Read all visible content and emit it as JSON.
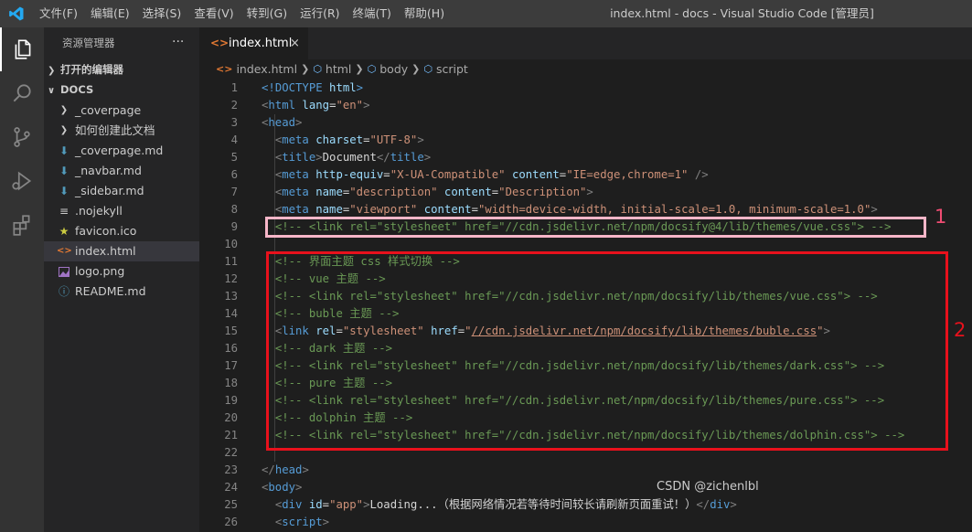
{
  "window": {
    "title": "index.html - docs - Visual Studio Code [管理员]"
  },
  "menu": [
    "文件(F)",
    "编辑(E)",
    "选择(S)",
    "查看(V)",
    "转到(G)",
    "运行(R)",
    "终端(T)",
    "帮助(H)"
  ],
  "sidebar": {
    "title": "资源管理器",
    "more": "···",
    "open_editors": "打开的编辑器",
    "folder": "DOCS",
    "items": [
      {
        "label": "_coverpage",
        "icon": "chevron-right-icon"
      },
      {
        "label": "如何创建此文档",
        "icon": "chevron-right-icon"
      },
      {
        "label": "_coverpage.md",
        "icon": "markdown-icon"
      },
      {
        "label": "_navbar.md",
        "icon": "markdown-icon"
      },
      {
        "label": "_sidebar.md",
        "icon": "markdown-icon"
      },
      {
        "label": ".nojekyll",
        "icon": "lines-icon"
      },
      {
        "label": "favicon.ico",
        "icon": "star-icon"
      },
      {
        "label": "index.html",
        "icon": "html-icon"
      },
      {
        "label": "logo.png",
        "icon": "image-icon"
      },
      {
        "label": "README.md",
        "icon": "info-icon"
      }
    ]
  },
  "editor": {
    "tab_label": "index.html",
    "tab_close": "×",
    "breadcrumb": [
      "index.html",
      "html",
      "body",
      "script"
    ],
    "line_numbers": [
      "1",
      "2",
      "3",
      "4",
      "5",
      "6",
      "7",
      "8",
      "9",
      "10",
      "11",
      "12",
      "13",
      "14",
      "15",
      "16",
      "17",
      "18",
      "19",
      "20",
      "21",
      "22",
      "23",
      "24",
      "25",
      "26"
    ],
    "lines": [
      [
        [
          "<!",
          "tg"
        ],
        [
          "DOCTYPE",
          "tg"
        ],
        [
          " html",
          "at"
        ],
        [
          ">",
          "tg"
        ]
      ],
      [
        [
          "<",
          "gr"
        ],
        [
          "html",
          "tg"
        ],
        [
          " lang",
          "at"
        ],
        [
          "=",
          "tx"
        ],
        [
          "\"en\"",
          "st"
        ],
        [
          ">",
          "gr"
        ]
      ],
      [
        [
          "<",
          "gr"
        ],
        [
          "head",
          "tg"
        ],
        [
          ">",
          "gr"
        ]
      ],
      [
        [
          "  ",
          "tx"
        ],
        [
          "<",
          "gr"
        ],
        [
          "meta",
          "tg"
        ],
        [
          " charset",
          "at"
        ],
        [
          "=",
          "tx"
        ],
        [
          "\"UTF-8\"",
          "st"
        ],
        [
          ">",
          "gr"
        ]
      ],
      [
        [
          "  ",
          "tx"
        ],
        [
          "<",
          "gr"
        ],
        [
          "title",
          "tg"
        ],
        [
          ">",
          "gr"
        ],
        [
          "Document",
          "tx"
        ],
        [
          "</",
          "gr"
        ],
        [
          "title",
          "tg"
        ],
        [
          ">",
          "gr"
        ]
      ],
      [
        [
          "  ",
          "tx"
        ],
        [
          "<",
          "gr"
        ],
        [
          "meta",
          "tg"
        ],
        [
          " http-equiv",
          "at"
        ],
        [
          "=",
          "tx"
        ],
        [
          "\"X-UA-Compatible\"",
          "st"
        ],
        [
          " content",
          "at"
        ],
        [
          "=",
          "tx"
        ],
        [
          "\"IE=edge,chrome=1\"",
          "st"
        ],
        [
          " />",
          "gr"
        ]
      ],
      [
        [
          "  ",
          "tx"
        ],
        [
          "<",
          "gr"
        ],
        [
          "meta",
          "tg"
        ],
        [
          " name",
          "at"
        ],
        [
          "=",
          "tx"
        ],
        [
          "\"description\"",
          "st"
        ],
        [
          " content",
          "at"
        ],
        [
          "=",
          "tx"
        ],
        [
          "\"Description\"",
          "st"
        ],
        [
          ">",
          "gr"
        ]
      ],
      [
        [
          "  ",
          "tx"
        ],
        [
          "<",
          "gr"
        ],
        [
          "meta",
          "tg"
        ],
        [
          " name",
          "at"
        ],
        [
          "=",
          "tx"
        ],
        [
          "\"viewport\"",
          "st"
        ],
        [
          " content",
          "at"
        ],
        [
          "=",
          "tx"
        ],
        [
          "\"width=device-width, initial-scale=1.0, minimum-scale=1.0\"",
          "st"
        ],
        [
          ">",
          "gr"
        ]
      ],
      [
        [
          "  ",
          "tx"
        ],
        [
          "<!-- <link rel=\"stylesheet\" href=\"//cdn.jsdelivr.net/npm/docsify@4/lib/themes/vue.css\"> -->",
          "cm"
        ]
      ],
      [],
      [
        [
          "  ",
          "tx"
        ],
        [
          "<!-- 界面主题 css 样式切换 -->",
          "cm"
        ]
      ],
      [
        [
          "  ",
          "tx"
        ],
        [
          "<!-- vue 主题 -->",
          "cm"
        ]
      ],
      [
        [
          "  ",
          "tx"
        ],
        [
          "<!-- <link rel=\"stylesheet\" href=\"//cdn.jsdelivr.net/npm/docsify/lib/themes/vue.css\"> -->",
          "cm"
        ]
      ],
      [
        [
          "  ",
          "tx"
        ],
        [
          "<!-- buble 主题 -->",
          "cm"
        ]
      ],
      [
        [
          "  ",
          "tx"
        ],
        [
          "<",
          "gr"
        ],
        [
          "link",
          "tg"
        ],
        [
          " rel",
          "at"
        ],
        [
          "=",
          "tx"
        ],
        [
          "\"stylesheet\"",
          "st"
        ],
        [
          " href",
          "at"
        ],
        [
          "=",
          "tx"
        ],
        [
          "\"",
          "st"
        ],
        [
          "//cdn.jsdelivr.net/npm/docsify/lib/themes/buble.css",
          "st ul"
        ],
        [
          "\"",
          "st"
        ],
        [
          ">",
          "gr"
        ]
      ],
      [
        [
          "  ",
          "tx"
        ],
        [
          "<!-- dark 主题 -->",
          "cm"
        ]
      ],
      [
        [
          "  ",
          "tx"
        ],
        [
          "<!-- <link rel=\"stylesheet\" href=\"//cdn.jsdelivr.net/npm/docsify/lib/themes/dark.css\"> -->",
          "cm"
        ]
      ],
      [
        [
          "  ",
          "tx"
        ],
        [
          "<!-- pure 主题 -->",
          "cm"
        ]
      ],
      [
        [
          "  ",
          "tx"
        ],
        [
          "<!-- <link rel=\"stylesheet\" href=\"//cdn.jsdelivr.net/npm/docsify/lib/themes/pure.css\"> -->",
          "cm"
        ]
      ],
      [
        [
          "  ",
          "tx"
        ],
        [
          "<!-- dolphin 主题 -->",
          "cm"
        ]
      ],
      [
        [
          "  ",
          "tx"
        ],
        [
          "<!-- <link rel=\"stylesheet\" href=\"//cdn.jsdelivr.net/npm/docsify/lib/themes/dolphin.css\"> -->",
          "cm"
        ]
      ],
      [],
      [
        [
          "</",
          "gr"
        ],
        [
          "head",
          "tg"
        ],
        [
          ">",
          "gr"
        ]
      ],
      [
        [
          "<",
          "gr"
        ],
        [
          "body",
          "tg"
        ],
        [
          ">",
          "gr"
        ]
      ],
      [
        [
          "  ",
          "tx"
        ],
        [
          "<",
          "gr"
        ],
        [
          "div",
          "tg"
        ],
        [
          " id",
          "at"
        ],
        [
          "=",
          "tx"
        ],
        [
          "\"app\"",
          "st"
        ],
        [
          ">",
          "gr"
        ],
        [
          "Loading...（根据网络情况若等待时间较长请刷新页面重试！）",
          "tx"
        ],
        [
          "</",
          "gr"
        ],
        [
          "div",
          "tg"
        ],
        [
          ">",
          "gr"
        ]
      ],
      [
        [
          "  ",
          "tx"
        ],
        [
          "<",
          "gr"
        ],
        [
          "script",
          "tg"
        ],
        [
          ">",
          "gr"
        ]
      ]
    ]
  },
  "annotations": {
    "box1_label": "1",
    "box2_label": "2"
  },
  "watermark": "CSDN @zichenlbl",
  "colors": {
    "titlebar": "#3c3c3c",
    "activitybar": "#333333",
    "sidebar": "#252526",
    "editor": "#1e1e1e",
    "tag": "#569cd6",
    "attr": "#9cdcfe",
    "string": "#ce9178",
    "comment": "#6a9955",
    "box1": "#f7b6c8",
    "box2": "#e8111c"
  }
}
